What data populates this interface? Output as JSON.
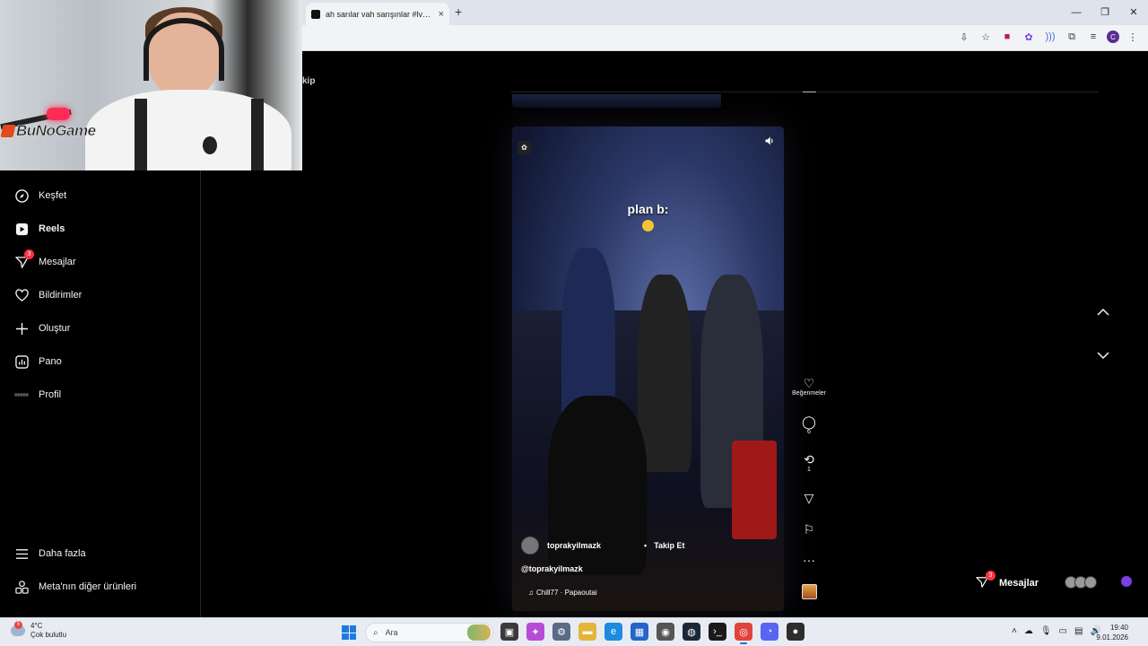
{
  "browser": {
    "tab_title": "ah sarılar vah sarışınlar #lvbelc5",
    "new_tab": "+",
    "tab_close": "×",
    "window_controls": [
      "—",
      "❐",
      "✕"
    ],
    "profile_initial": "C"
  },
  "brand": {
    "name": "BuNoGame"
  },
  "sidebar": {
    "items": [
      {
        "label": "Keşfet",
        "icon": "compass-icon"
      },
      {
        "label": "Reels",
        "icon": "reels-icon"
      },
      {
        "label": "Mesajlar",
        "icon": "messenger-icon",
        "badge": "3"
      },
      {
        "label": "Bildirimler",
        "icon": "heart-icon"
      },
      {
        "label": "Oluştur",
        "icon": "plus-icon"
      },
      {
        "label": "Pano",
        "icon": "dashboard-icon"
      },
      {
        "label": "Profil",
        "icon": "profile-avatar"
      }
    ],
    "bottom": [
      {
        "label": "Daha fazla",
        "icon": "menu-icon"
      },
      {
        "label": "Meta'nın diğer ürünleri",
        "icon": "apps-icon"
      }
    ]
  },
  "header": {
    "takip_fragment": "kip"
  },
  "reel": {
    "caption": "plan b:",
    "author": "toprakyilmazk",
    "follow_dot": "•",
    "follow_label": "Takip Et",
    "handle": "@toprakyilmazk",
    "music": "Chill77 · Papaoutai"
  },
  "actions": {
    "like_label": "Beğenmeler",
    "comment_count": "6",
    "repost_count": "1"
  },
  "messages_pill": {
    "label": "Mesajlar",
    "badge": "3"
  },
  "taskbar": {
    "weather_temp": "4°C",
    "weather_desc": "Çok bulutlu",
    "weather_badge": "5",
    "search_placeholder": "Ara",
    "time": "19:40",
    "date": "9.01.2026"
  }
}
